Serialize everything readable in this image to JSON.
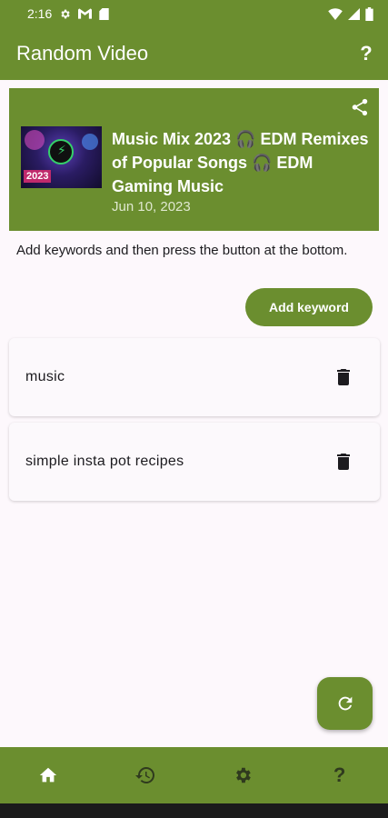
{
  "status": {
    "time": "2:16",
    "icons": [
      "gear-icon",
      "gmail-icon",
      "sim-icon",
      "wifi-icon",
      "signal-icon",
      "battery-icon"
    ]
  },
  "appbar": {
    "title": "Random Video",
    "help_label": "?"
  },
  "video": {
    "title": "Music Mix 2023 🎧 EDM Remixes of Popular Songs 🎧 EDM Gaming Music",
    "date": "Jun 10, 2023",
    "thumbnail_badge": "2023"
  },
  "instructions": "Add keywords and then press the button at the bottom.",
  "add_keyword_label": "Add keyword",
  "keywords": [
    {
      "text": "music"
    },
    {
      "text": "simple insta pot recipes"
    }
  ],
  "nav": {
    "help_label": "?",
    "items": [
      "home-icon",
      "history-icon",
      "settings-icon",
      "help-icon"
    ]
  },
  "colors": {
    "primary": "#6b8e2f",
    "background": "#fdf8fc"
  }
}
